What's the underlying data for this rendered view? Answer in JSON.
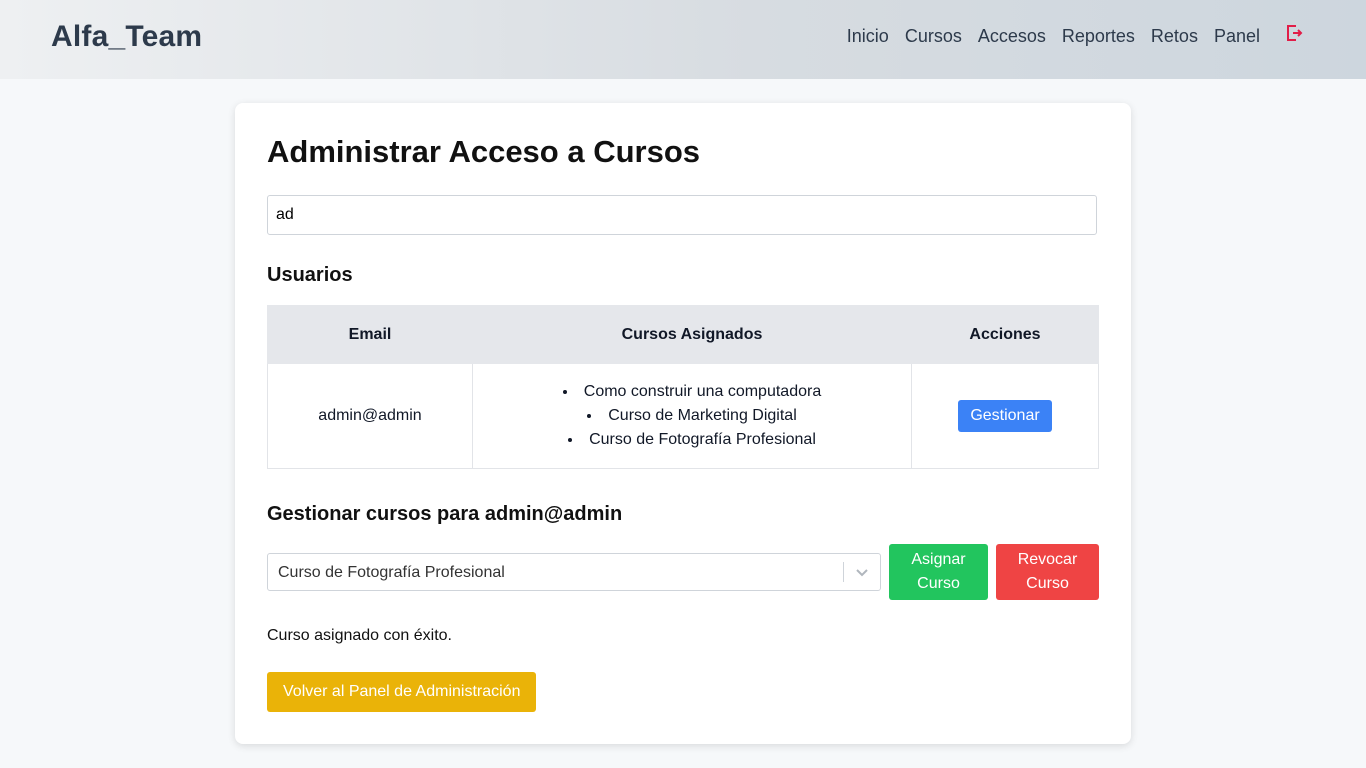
{
  "header": {
    "brand": "Alfa_Team",
    "nav": [
      "Inicio",
      "Cursos",
      "Accesos",
      "Reportes",
      "Retos",
      "Panel"
    ],
    "logout_icon": "logout-icon",
    "logout_color": "#e11d48"
  },
  "page": {
    "title": "Administrar Acceso a Cursos",
    "search_value": "ad",
    "users_heading": "Usuarios",
    "table": {
      "headers": [
        "Email",
        "Cursos Asignados",
        "Acciones"
      ],
      "rows": [
        {
          "email": "admin@admin",
          "courses": [
            "Como construir una computadora",
            "Curso de Marketing Digital",
            "Curso de Fotografía Profesional"
          ],
          "action": "Gestionar"
        }
      ]
    },
    "manage": {
      "heading": "Gestionar cursos para admin@admin",
      "selected_course": "Curso de Fotografía Profesional",
      "assign_label": "Asignar Curso",
      "revoke_label": "Revocar Curso",
      "status_message": "Curso asignado con éxito."
    },
    "back_label": "Volver al Panel de Administración"
  },
  "colors": {
    "primary": "#3b82f6",
    "success": "#22c55e",
    "danger": "#ef4444",
    "warning": "#eab308"
  }
}
